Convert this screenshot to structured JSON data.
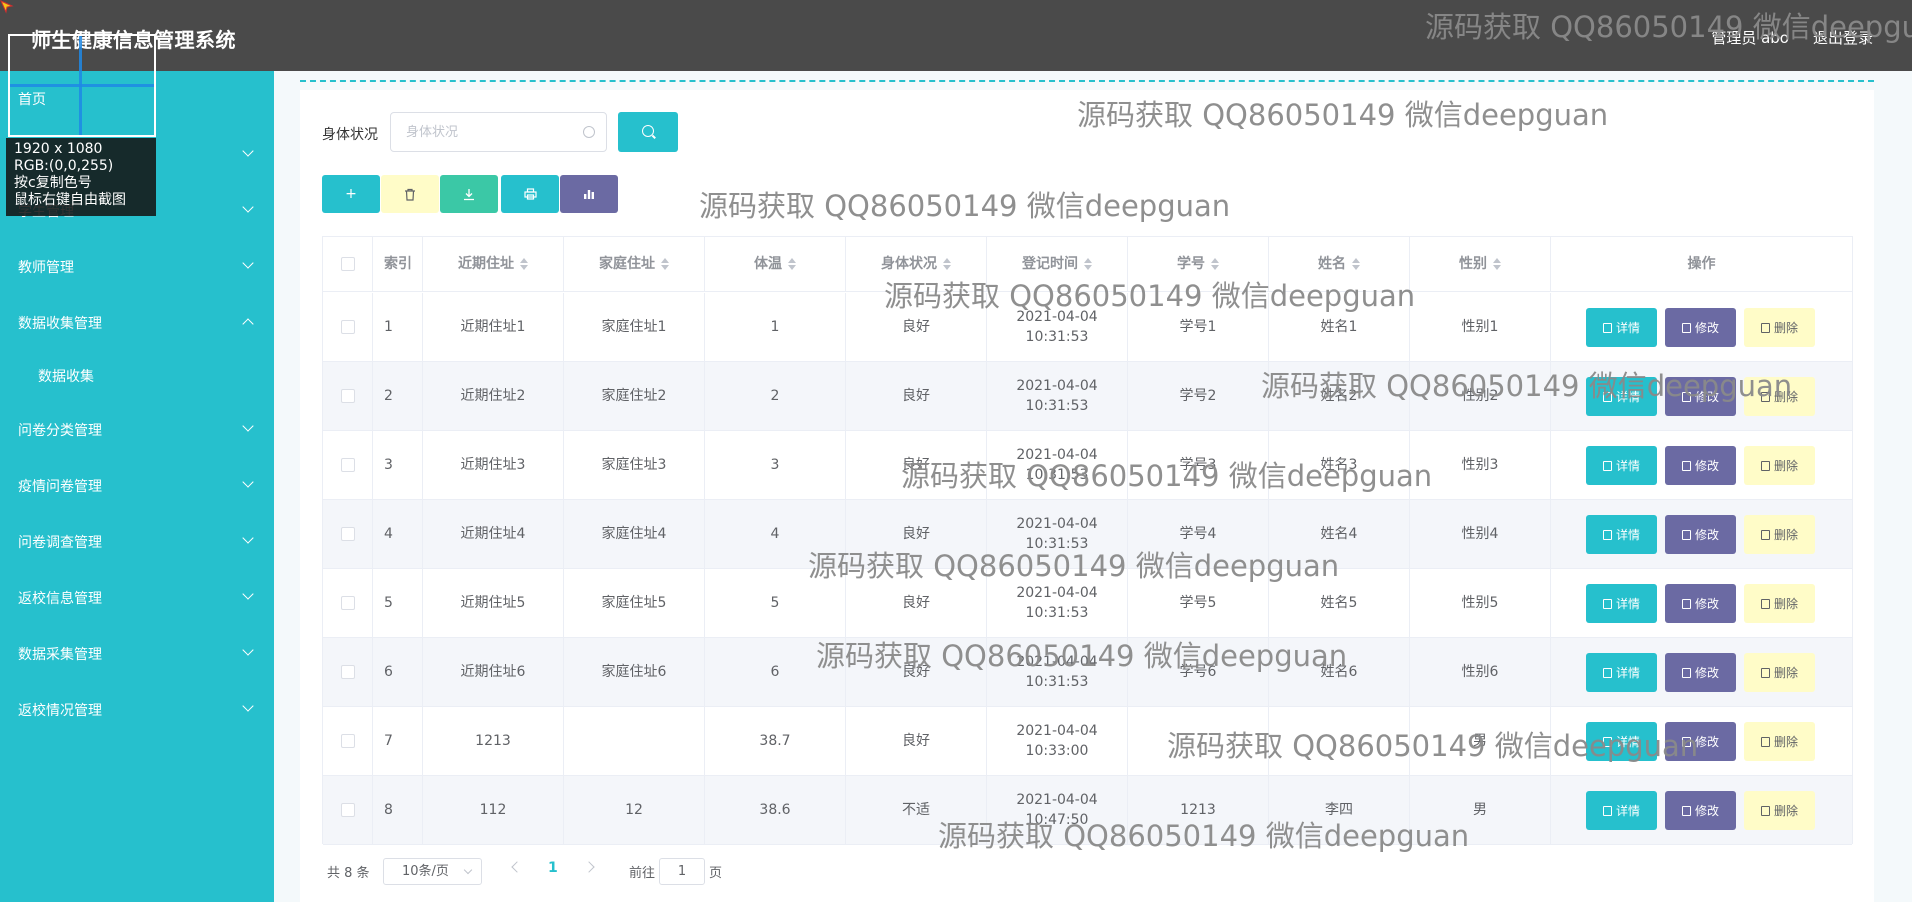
{
  "header": {
    "title": "师生健康信息管理系统",
    "user_label": "管理员 abo",
    "logout_label": "退出登录"
  },
  "sidebar": {
    "items": [
      {
        "label": "首页",
        "expandable": false
      },
      {
        "label": "",
        "expandable": true
      },
      {
        "label": "学生管理",
        "expandable": true
      },
      {
        "label": "教师管理",
        "expandable": true
      },
      {
        "label": "数据收集管理",
        "expandable": true,
        "expanded": true
      },
      {
        "label": "数据收集",
        "expandable": false,
        "sub": true
      },
      {
        "label": "问卷分类管理",
        "expandable": true
      },
      {
        "label": "疫情问卷管理",
        "expandable": true
      },
      {
        "label": "问卷调查管理",
        "expandable": true
      },
      {
        "label": "返校信息管理",
        "expandable": true
      },
      {
        "label": "数据采集管理",
        "expandable": true
      },
      {
        "label": "返校情况管理",
        "expandable": true
      }
    ]
  },
  "capture_overlay": {
    "lines": [
      "1920 x 1080",
      "RGB:(0,0,255)",
      "按c复制色号",
      "鼠标右键自由截图"
    ]
  },
  "filter": {
    "label": "身体状况",
    "placeholder": "身体状况"
  },
  "toolbar": {
    "buttons": [
      {
        "icon": "plus-icon",
        "color": "#26c0cd"
      },
      {
        "icon": "trash-icon",
        "color": "#fffcc8"
      },
      {
        "icon": "download-icon",
        "color": "#3bc8a6"
      },
      {
        "icon": "print-icon",
        "color": "#26c0cd"
      },
      {
        "icon": "bar-chart-icon",
        "color": "#6b6aa3"
      }
    ]
  },
  "table": {
    "headers": [
      "索引",
      "近期住址",
      "家庭住址",
      "体温",
      "身体状况",
      "登记时间",
      "学号",
      "姓名",
      "性别",
      "操作"
    ],
    "rows": [
      {
        "index": "1",
        "recent_address": "近期住址1",
        "home_address": "家庭住址1",
        "temperature": "1",
        "health": "良好",
        "time": "2021-04-04 10:31:53",
        "student_id": "学号1",
        "name": "姓名1",
        "gender": "性别1"
      },
      {
        "index": "2",
        "recent_address": "近期住址2",
        "home_address": "家庭住址2",
        "temperature": "2",
        "health": "良好",
        "time": "2021-04-04 10:31:53",
        "student_id": "学号2",
        "name": "姓名2",
        "gender": "性别2"
      },
      {
        "index": "3",
        "recent_address": "近期住址3",
        "home_address": "家庭住址3",
        "temperature": "3",
        "health": "良好",
        "time": "2021-04-04 10:31:53",
        "student_id": "学号3",
        "name": "姓名3",
        "gender": "性别3"
      },
      {
        "index": "4",
        "recent_address": "近期住址4",
        "home_address": "家庭住址4",
        "temperature": "4",
        "health": "良好",
        "time": "2021-04-04 10:31:53",
        "student_id": "学号4",
        "name": "姓名4",
        "gender": "性别4"
      },
      {
        "index": "5",
        "recent_address": "近期住址5",
        "home_address": "家庭住址5",
        "temperature": "5",
        "health": "良好",
        "time": "2021-04-04 10:31:53",
        "student_id": "学号5",
        "name": "姓名5",
        "gender": "性别5"
      },
      {
        "index": "6",
        "recent_address": "近期住址6",
        "home_address": "家庭住址6",
        "temperature": "6",
        "health": "良好",
        "time": "2021-04-04 10:31:53",
        "student_id": "学号6",
        "name": "姓名6",
        "gender": "性别6"
      },
      {
        "index": "7",
        "recent_address": "1213",
        "home_address": "",
        "temperature": "38.7",
        "health": "良好",
        "time": "2021-04-04 10:33:00",
        "student_id": "",
        "name": "",
        "gender": "男"
      },
      {
        "index": "8",
        "recent_address": "112",
        "home_address": "12",
        "temperature": "38.6",
        "health": "不适",
        "time": "2021-04-04 10:47:50",
        "student_id": "1213",
        "name": "李四",
        "gender": "男"
      }
    ],
    "actions": {
      "detail": "详情",
      "edit": "修改",
      "delete": "删除"
    }
  },
  "pagination": {
    "total": "共 8 条",
    "page_size": "10条/页",
    "current_page": "1",
    "goto_label": "前往",
    "goto_value": "1",
    "goto_suffix": "页"
  },
  "watermark": {
    "text": "源码获取 QQ86050149 微信deepguan"
  },
  "colors": {
    "sidebar": "#26c0cd",
    "topbar": "#4a4a4a",
    "accent": "#26c0cd",
    "edit": "#6b6aa3",
    "delete": "#fffcc8"
  }
}
